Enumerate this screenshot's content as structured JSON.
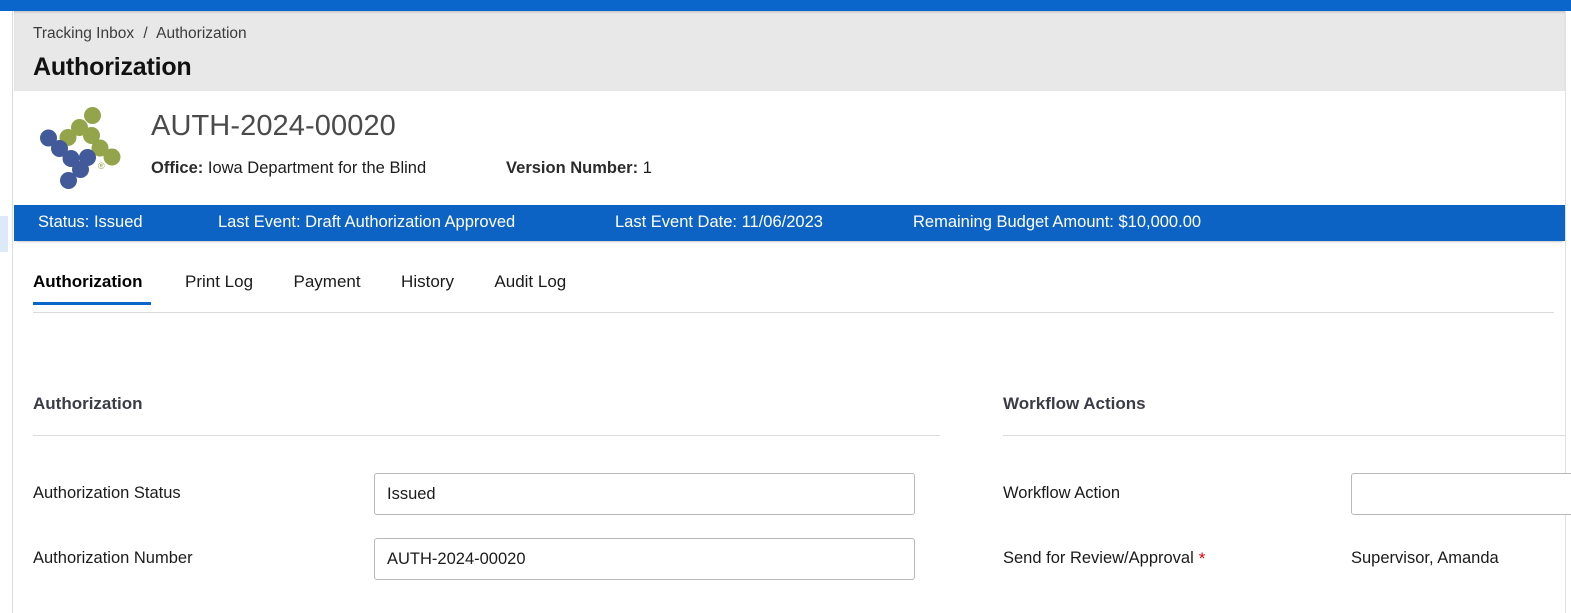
{
  "theme": {
    "accent_blue": "#0b66cc",
    "ribbon_blue": "#0d63c4",
    "header_gray": "#e8e8e8",
    "required_red": "#d8000c",
    "logo_blue": "#42599a",
    "logo_green": "#93a44b"
  },
  "breadcrumb": {
    "items": [
      "Tracking Inbox",
      "Authorization"
    ],
    "separator": "/"
  },
  "page_title": "Authorization",
  "record_header": {
    "logo_name": "iowa-vr-dots-logo",
    "record_id": "AUTH-2024-00020",
    "meta": [
      {
        "label": "Office:",
        "value": "Iowa Department for the Blind"
      },
      {
        "label": "Version Number:",
        "value": "1"
      }
    ]
  },
  "status_ribbon": {
    "items": [
      "Status: Issued",
      "Last Event: Draft Authorization Approved",
      "Last Event Date: 11/06/2023",
      "Remaining Budget Amount: $10,000.00"
    ]
  },
  "tabs": [
    {
      "label": "Authorization",
      "active": true
    },
    {
      "label": "Print Log",
      "active": false
    },
    {
      "label": "Payment",
      "active": false
    },
    {
      "label": "History",
      "active": false
    },
    {
      "label": "Audit Log",
      "active": false
    }
  ],
  "left_panel": {
    "heading": "Authorization",
    "fields": [
      {
        "label": "Authorization Status",
        "value": "Issued",
        "placeholder": "",
        "type": "input",
        "required": false
      },
      {
        "label": "Authorization Number",
        "value": "AUTH-2024-00020",
        "placeholder": "",
        "type": "input",
        "required": false
      }
    ]
  },
  "right_panel": {
    "heading": "Workflow Actions",
    "fields": [
      {
        "label": "Workflow Action",
        "value": "",
        "placeholder": "",
        "type": "input",
        "required": false
      },
      {
        "label": "Send for Review/Approval",
        "value": "Supervisor, Amanda",
        "placeholder": "",
        "type": "static",
        "required": true
      }
    ]
  }
}
